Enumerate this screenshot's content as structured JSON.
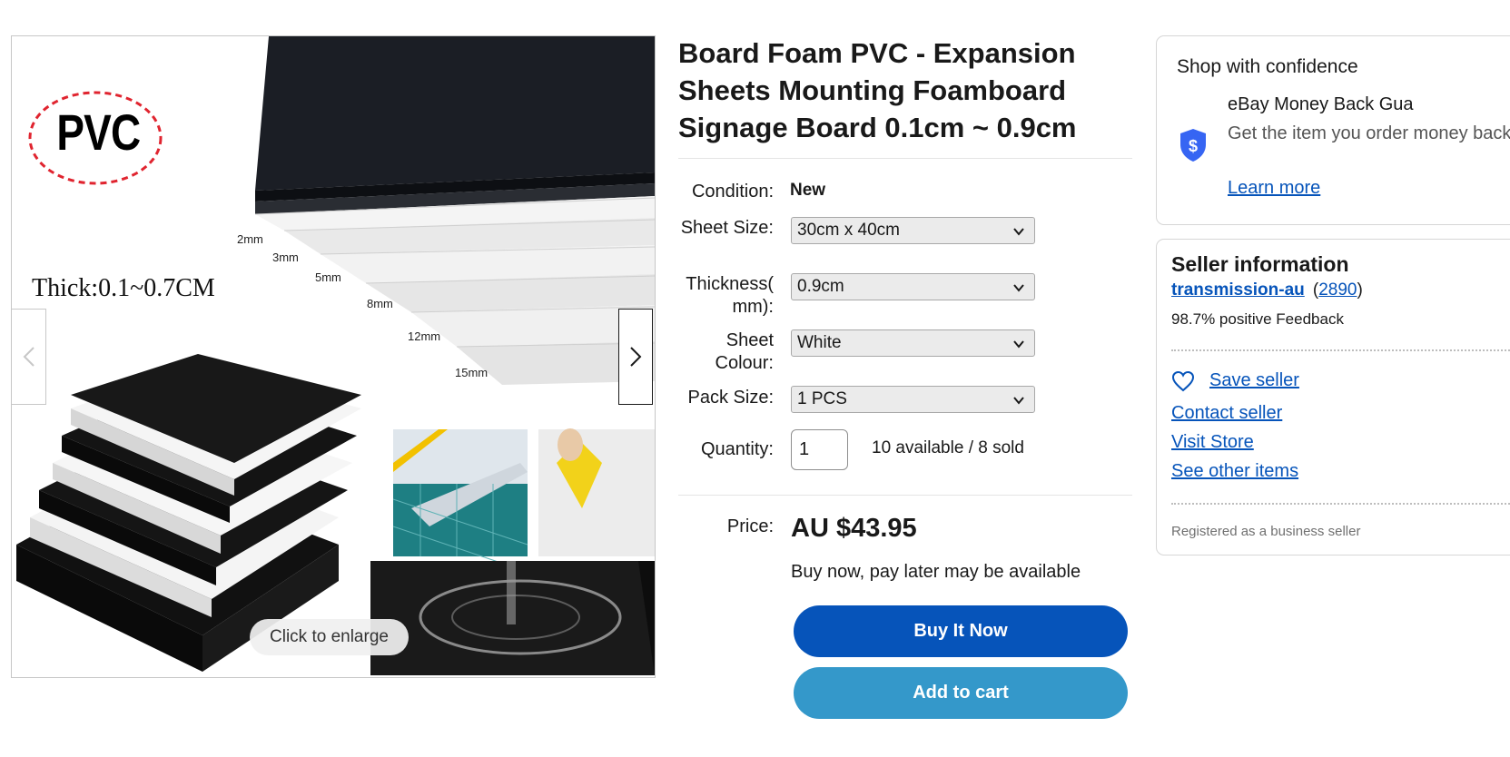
{
  "gallery": {
    "badge_text": "PVC",
    "thickness_text": "Thick:0.1~0.7CM",
    "thickness_labels": [
      "2mm",
      "3mm",
      "5mm",
      "8mm",
      "12mm",
      "15mm"
    ],
    "enlarge_label": "Click to enlarge"
  },
  "product": {
    "title": "Board Foam PVC - Expansion Sheets Mounting Foamboard Signage Board 0.1cm ~ 0.9cm",
    "condition_label": "Condition:",
    "condition_value": "New",
    "options": [
      {
        "label": "Sheet Size:",
        "value": "30cm x 40cm"
      },
      {
        "label": "Thickness( mm):",
        "value": "0.9cm"
      },
      {
        "label": "Sheet Colour:",
        "value": "White"
      },
      {
        "label": "Pack Size:",
        "value": "1 PCS"
      }
    ],
    "quantity_label": "Quantity:",
    "quantity_value": "1",
    "availability": "10 available / 8 sold",
    "price_label": "Price:",
    "price": "AU $43.95",
    "bnpl": "Buy now, pay later may be available",
    "buy_now_label": "Buy It Now",
    "add_to_cart_label": "Add to cart"
  },
  "confidence": {
    "title": "Shop with confidence",
    "mbg_title": "eBay Money Back Gua",
    "mbg_desc": "Get the item you order money back.",
    "learn_more": "Learn more"
  },
  "seller": {
    "title": "Seller information",
    "username": "transmission-au",
    "feedback_count": "2890",
    "feedback_percent": "98.7% positive Feedback",
    "save_seller": "Save seller",
    "contact_seller": "Contact seller",
    "visit_store": "Visit Store",
    "see_other_items": "See other items",
    "registered": "Registered as a business seller"
  },
  "colors": {
    "primary_button": "#0654ba",
    "secondary_button": "#3498ca",
    "link": "#0654ba"
  },
  "icons": [
    "chevron-left-icon",
    "chevron-right-icon",
    "chevron-down-icon",
    "shield-dollar-icon",
    "heart-icon"
  ]
}
